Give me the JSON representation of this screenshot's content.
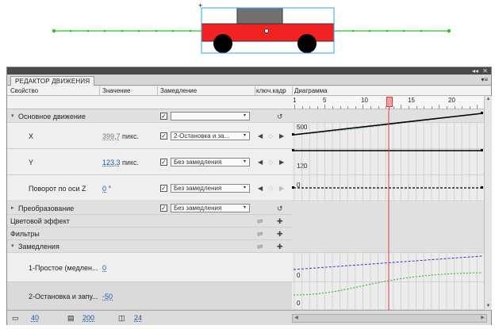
{
  "panel": {
    "tab_label": "РЕДАКТОР ДВИЖЕНИЯ",
    "collapse_glyph": "◂◂",
    "close_glyph": "✕",
    "menu_glyph": "▾≡"
  },
  "columns": {
    "property": "Свойство",
    "value": "Значение",
    "easing": "Замедление",
    "keyframe": "ключ.кадр",
    "graph": "Диаграмма"
  },
  "ruler": {
    "labels": [
      "1",
      "5",
      "10",
      "15",
      "20"
    ],
    "playhead_frame": 13
  },
  "rows": {
    "basic_motion": {
      "label": "Основное движение",
      "easing": ""
    },
    "x": {
      "label": "X",
      "value": "399,7",
      "unit": "пикс.",
      "easing": "2-Остановка и за...",
      "graph_label": "500"
    },
    "y": {
      "label": "Y",
      "value": "123,3",
      "unit": "пикс.",
      "easing": "Без замедления",
      "graph_label": "120"
    },
    "rot": {
      "label": "Поворот по оси Z",
      "value": "0",
      "unit": "°",
      "easing": "Без замедления",
      "graph_label": "0"
    },
    "transform": {
      "label": "Преобразование",
      "easing": "Без замедления"
    },
    "color": {
      "label": "Цветовой эффект"
    },
    "filters": {
      "label": "Фильтры"
    },
    "easings": {
      "label": "Замедления"
    },
    "ease1": {
      "label": "1-Простое (медлен...",
      "value": "0",
      "graph_label": "0"
    },
    "ease2": {
      "label": "2-Остановка и запу...",
      "value": "-50",
      "graph_label": "0"
    }
  },
  "footer": {
    "graph_size": "40",
    "expanded_graph_size": "200",
    "viewable_frames": "24"
  },
  "icons": {
    "chevron_down": "▾",
    "chevron_right": "▸",
    "check": "✓",
    "kf_prev": "◀",
    "kf_add": "◇",
    "kf_next": "▶",
    "reset": "↺",
    "add": "✚",
    "remove": "⇌"
  },
  "colors": {
    "red_car": "#f22222",
    "playhead": "#e03a3a",
    "guide_green": "#27c427",
    "ease_blue": "#2a3ad0"
  }
}
